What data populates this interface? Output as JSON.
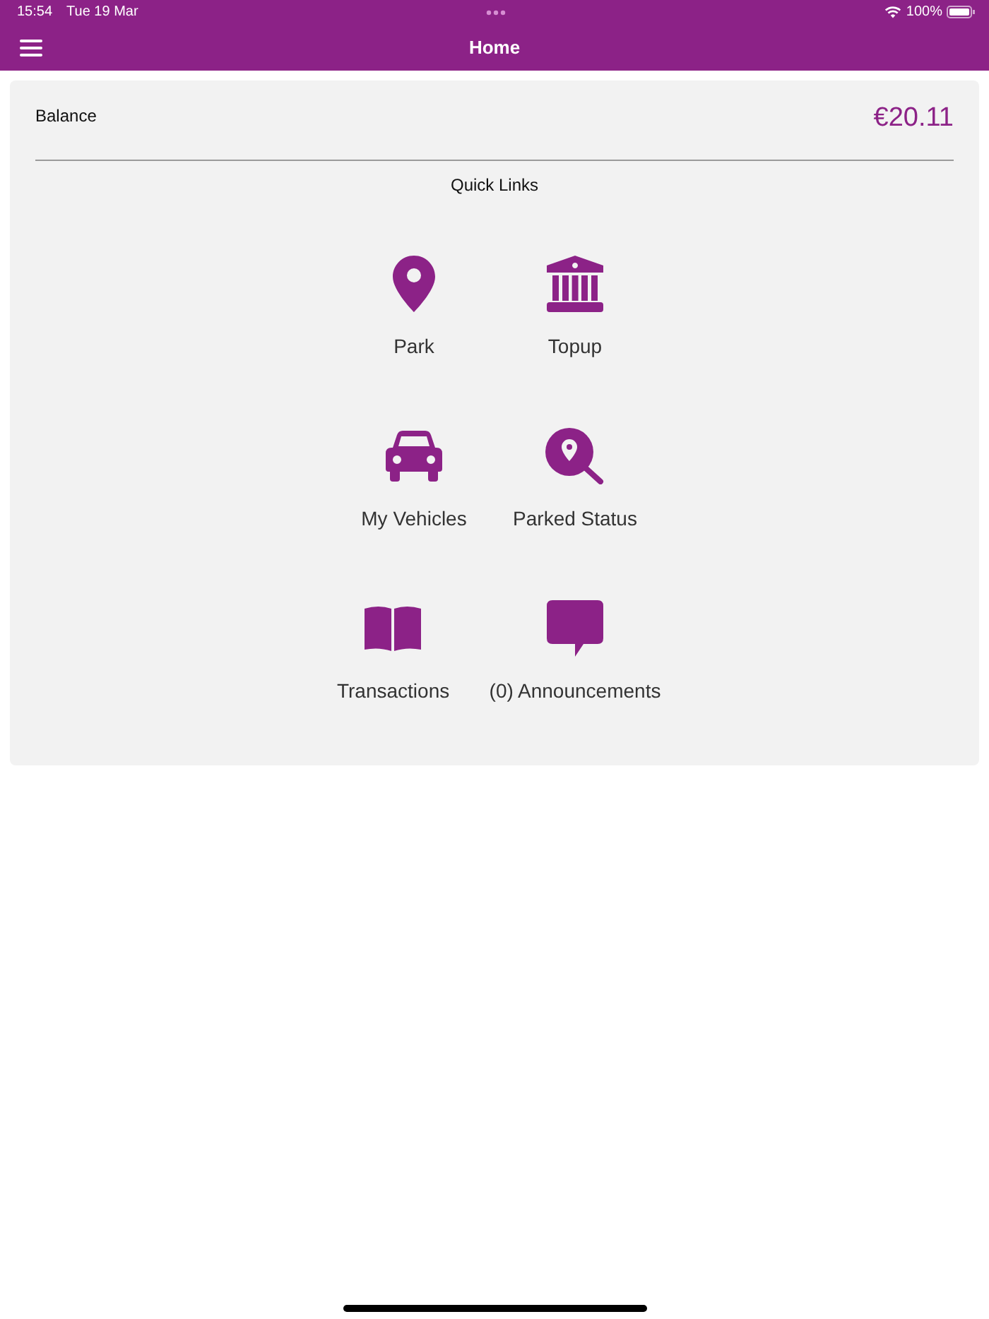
{
  "status_bar": {
    "time": "15:54",
    "date": "Tue 19 Mar",
    "battery": "100%"
  },
  "nav_bar": {
    "title": "Home"
  },
  "balance": {
    "label": "Balance",
    "amount": "€20.11"
  },
  "quick_links": {
    "title": "Quick Links",
    "items": [
      {
        "label": "Park",
        "kind": "pin"
      },
      {
        "label": "Topup",
        "kind": "bank"
      },
      {
        "label": "My Vehicles",
        "kind": "car"
      },
      {
        "label": "Parked Status",
        "kind": "search"
      },
      {
        "label": "Transactions",
        "kind": "book"
      },
      {
        "label": "(0) Announcements",
        "kind": "chat"
      }
    ]
  }
}
